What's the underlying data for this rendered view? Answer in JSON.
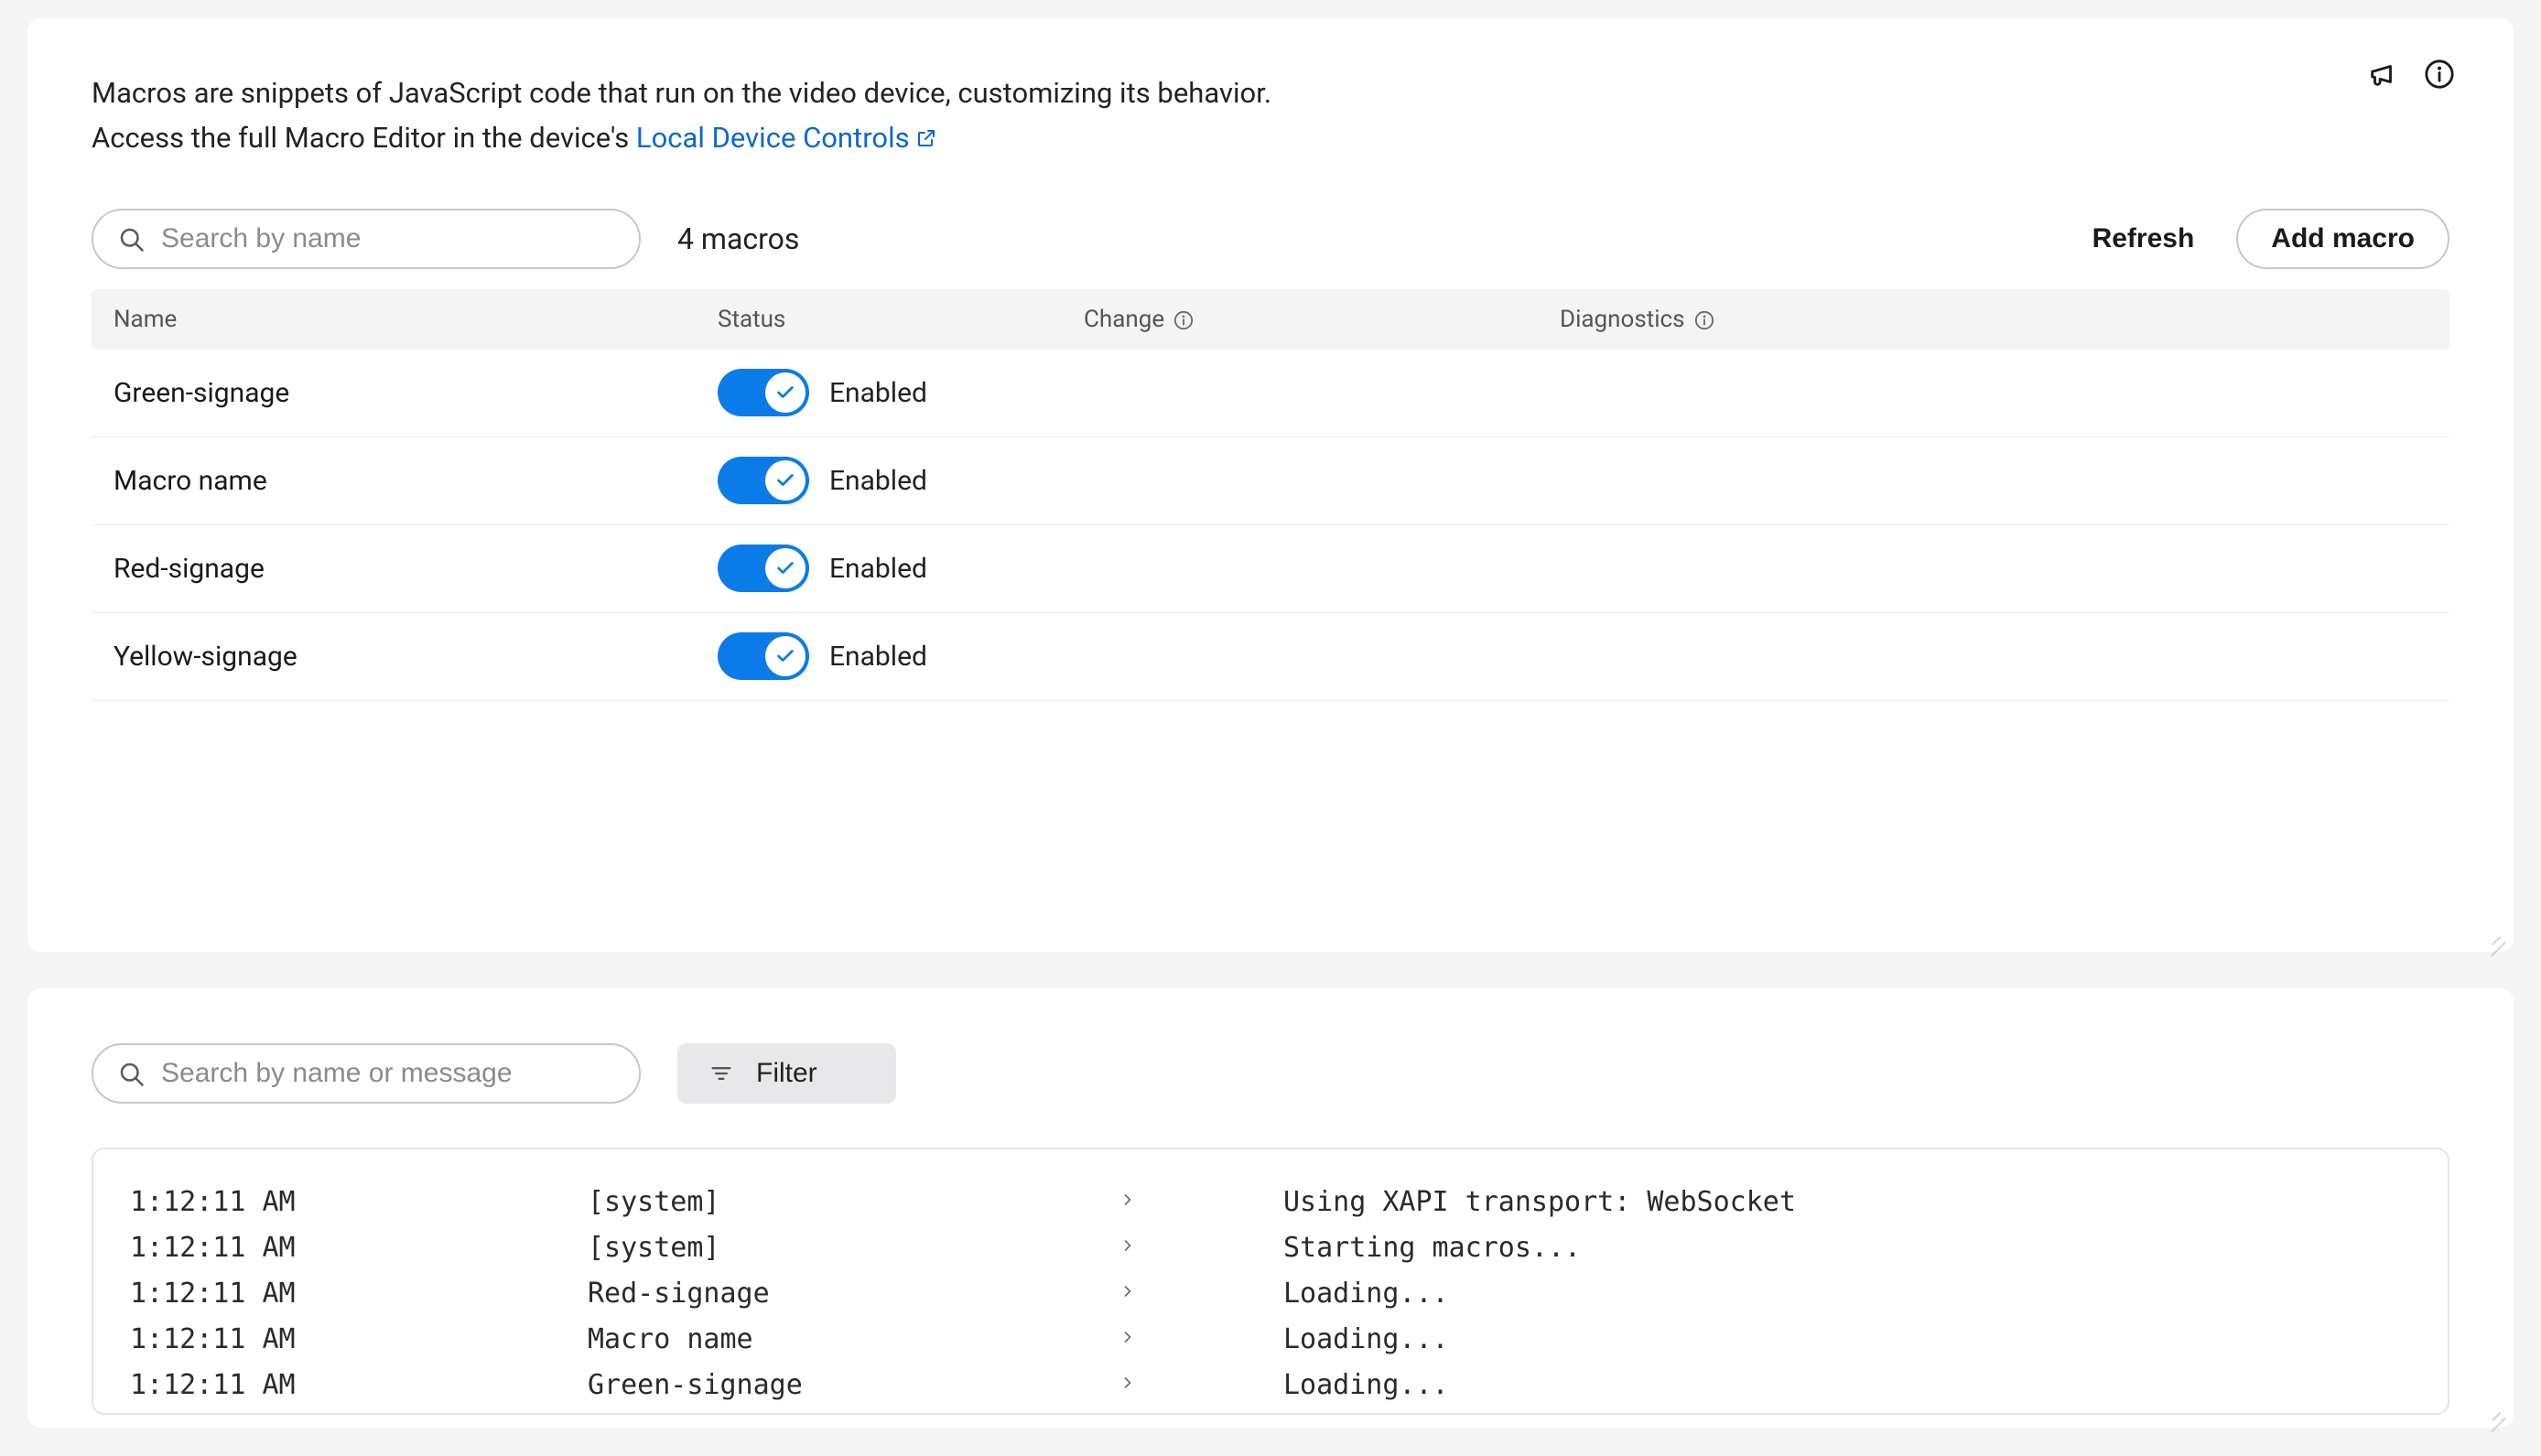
{
  "intro": {
    "line1": "Macros are snippets of JavaScript code that run on the video device, customizing its behavior.",
    "line2_prefix": "Access the full Macro Editor in the device's ",
    "link_text": "Local Device Controls"
  },
  "toolbar": {
    "search_placeholder": "Search by name",
    "count": "4 macros",
    "refresh": "Refresh",
    "add_macro": "Add macro"
  },
  "table": {
    "headers": {
      "name": "Name",
      "status": "Status",
      "change": "Change",
      "diagnostics": "Diagnostics"
    },
    "rows": [
      {
        "name": "Green-signage",
        "enabled": true,
        "status_text": "Enabled"
      },
      {
        "name": "Macro name",
        "enabled": true,
        "status_text": "Enabled"
      },
      {
        "name": "Red-signage",
        "enabled": true,
        "status_text": "Enabled"
      },
      {
        "name": "Yellow-signage",
        "enabled": true,
        "status_text": "Enabled"
      }
    ]
  },
  "log_toolbar": {
    "search_placeholder": "Search by name or message",
    "filter_label": "Filter"
  },
  "log": [
    {
      "time": "1:12:11 AM",
      "source": "[system]",
      "msg": "Using XAPI transport: WebSocket"
    },
    {
      "time": "1:12:11 AM",
      "source": "[system]",
      "msg": "Starting macros..."
    },
    {
      "time": "1:12:11 AM",
      "source": "Red-signage",
      "msg": "Loading..."
    },
    {
      "time": "1:12:11 AM",
      "source": "Macro name",
      "msg": "Loading..."
    },
    {
      "time": "1:12:11 AM",
      "source": "Green-signage",
      "msg": "Loading..."
    }
  ]
}
